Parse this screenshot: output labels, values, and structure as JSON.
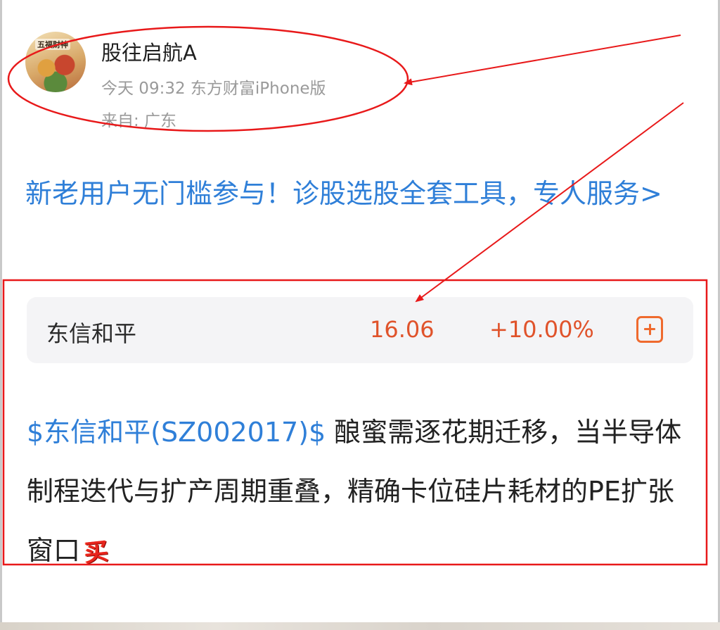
{
  "post": {
    "author": {
      "name": "股往启航A",
      "avatar_text": "五福财神",
      "time": "今天 09:32",
      "client": "东方财富iPhone版",
      "location": "来自: 广东"
    },
    "promo_link": "新老用户无门槛参与！诊股选股全套工具，专人服务>",
    "stock_card": {
      "name": "东信和平",
      "price": "16.06",
      "change": "+10.00%",
      "add_icon": "plus-square-icon"
    },
    "body": {
      "tag": "$东信和平(SZ002017)$",
      "text": "  酿蜜需逐花期迁移，当半导体制程迭代与扩产周期重叠，精确卡位硅片耗材的PE扩张窗口",
      "badge": "买"
    }
  },
  "colors": {
    "link_blue": "#2f7fd8",
    "price_red": "#e0532b",
    "annotation_red": "#e8191a",
    "card_bg": "#f4f4f6"
  }
}
